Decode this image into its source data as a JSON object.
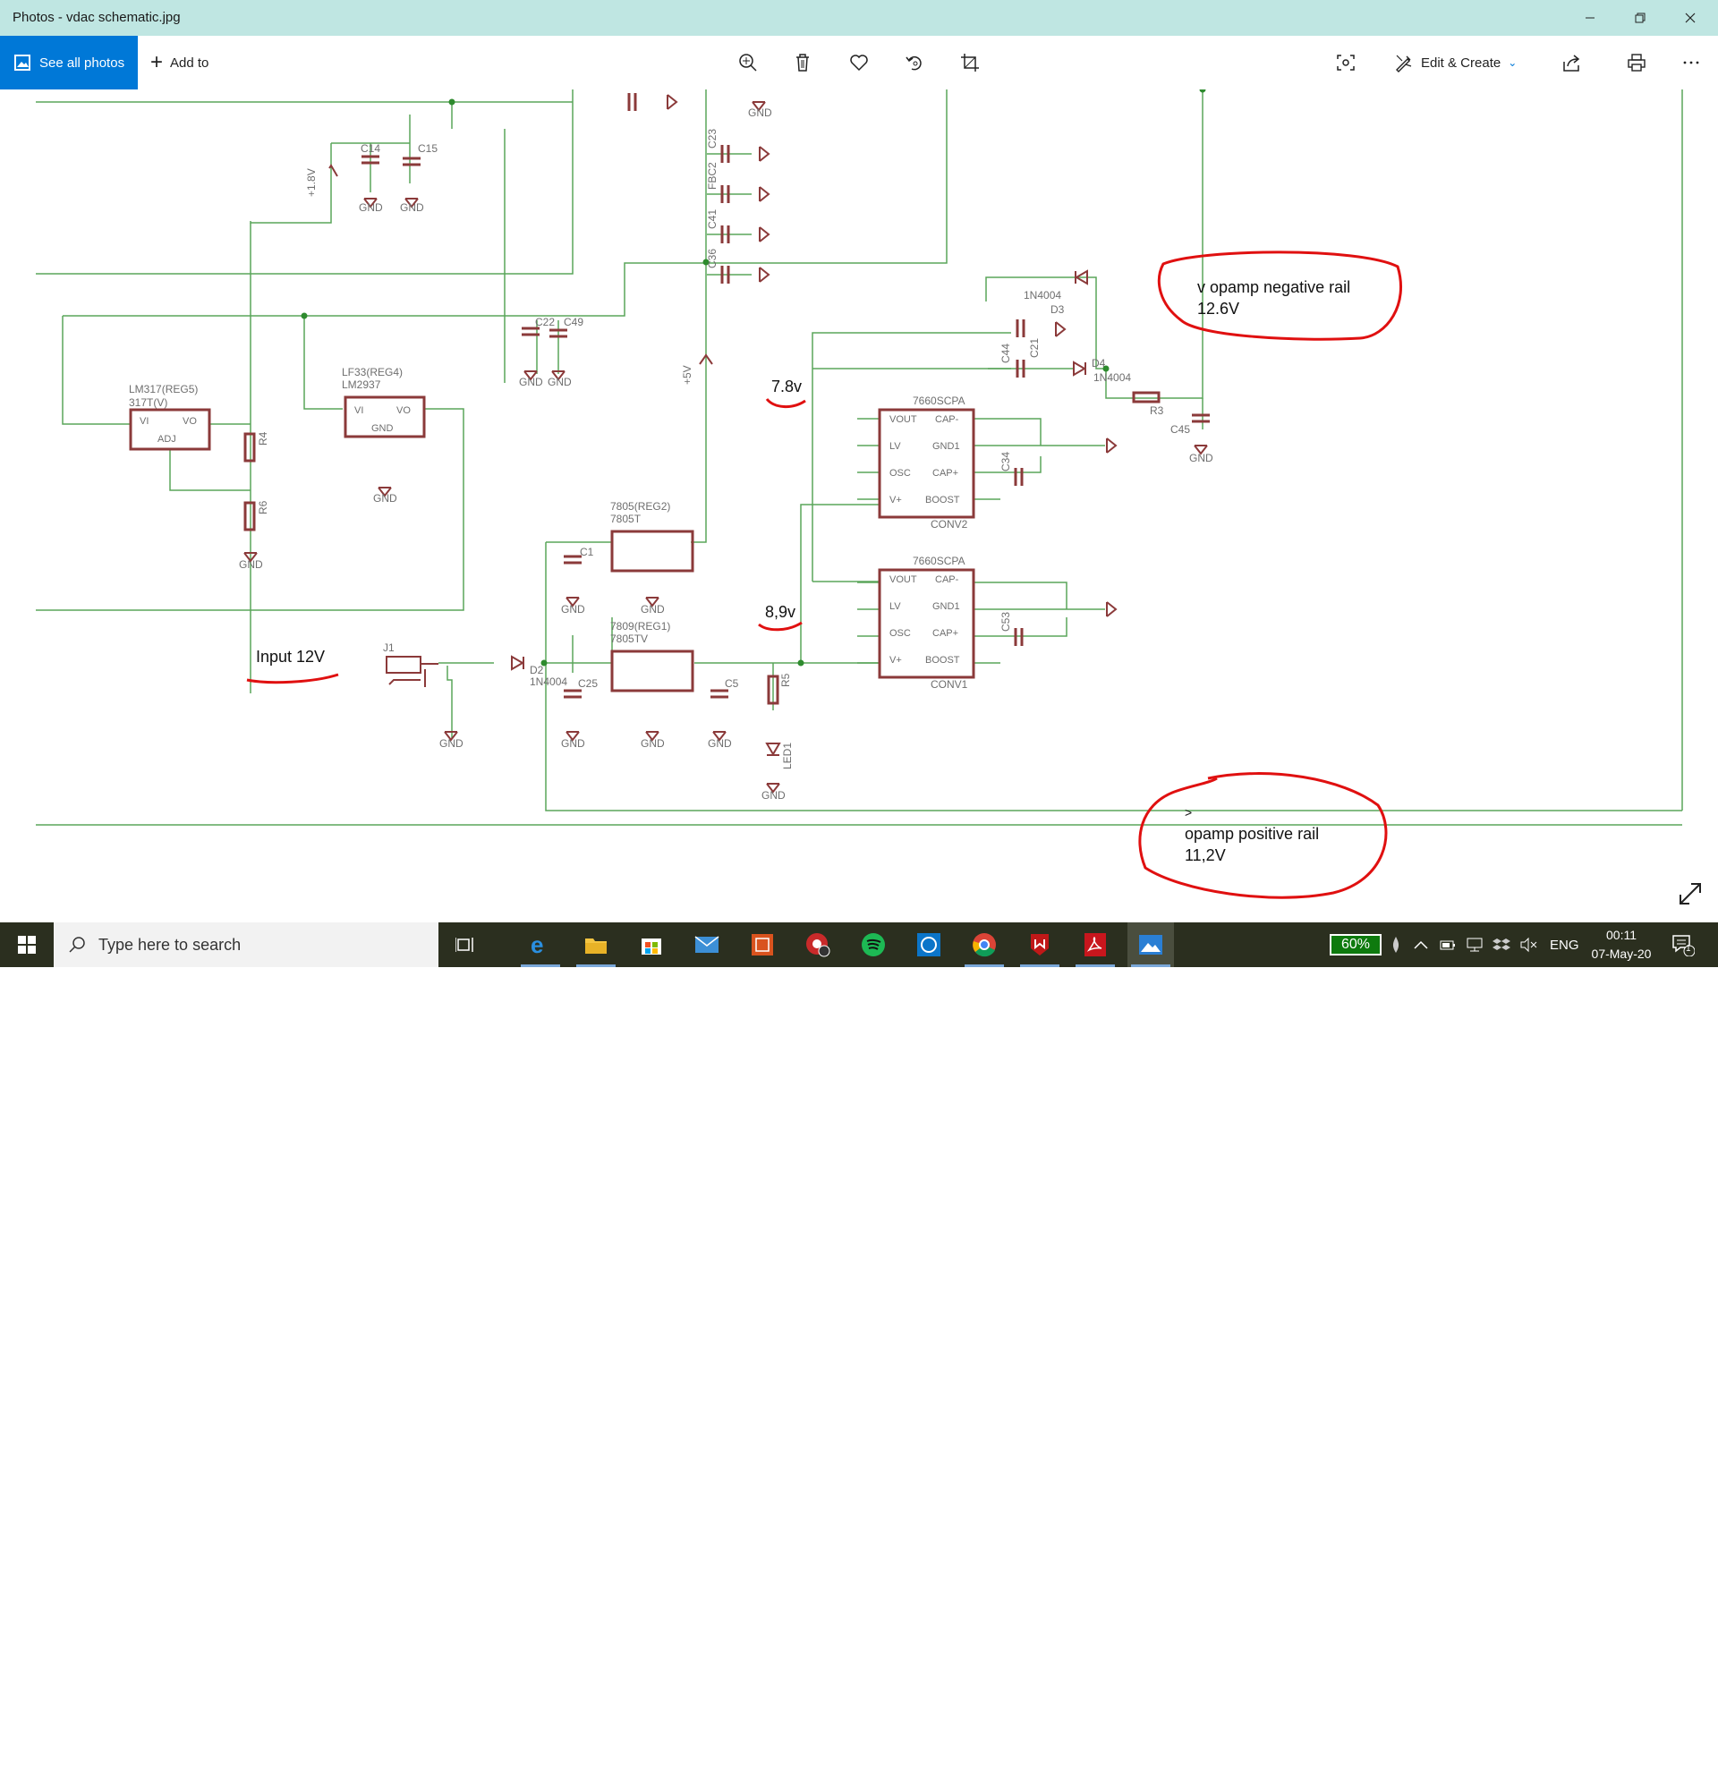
{
  "window": {
    "title": "Photos - vdac schematic.jpg",
    "controls": [
      "minimize",
      "restore",
      "close"
    ]
  },
  "toolbar": {
    "see_all_label": "See all photos",
    "add_to_label": "Add to",
    "edit_create_label": "Edit & Create",
    "icons": [
      "zoom-icon",
      "delete-icon",
      "favorite-icon",
      "rotate-icon",
      "crop-icon",
      "spot-fix-icon",
      "share-icon",
      "print-icon",
      "more-icon"
    ]
  },
  "schematic": {
    "annotations": {
      "input": "Input 12V",
      "v78": "7.8v",
      "v89": "8,9v",
      "neg_rail_line1": "v  opamp negative rail",
      "neg_rail_line2": "12.6V",
      "pos_rail_mark": ">",
      "pos_rail_line1": "opamp positive rail",
      "pos_rail_line2": "11,2V"
    },
    "parts": {
      "reg5_a": "LM317(REG5)",
      "reg5_b": "317T(V)",
      "reg5_vi": "VI",
      "reg5_vo": "VO",
      "reg5_adj": "ADJ",
      "reg4_a": "LF33(REG4)",
      "reg4_b": "LM2937",
      "reg4_vi": "VI",
      "reg4_vo": "VO",
      "reg4_gnd": "GND",
      "reg2_a": "7805(REG2)",
      "reg2_b": "7805T",
      "reg1_a": "7809(REG1)",
      "reg1_b": "7805TV",
      "conv_title": "7660SCPA",
      "conv2": "CONV2",
      "conv1": "CONV1",
      "pin_vout": "VOUT",
      "pin_lv": "LV",
      "pin_osc": "OSC",
      "pin_vplus": "V+",
      "pin_capm": "CAP-",
      "pin_gnd1": "GND1",
      "pin_capp": "CAP+",
      "pin_boost": "BOOST",
      "c14": "C14",
      "c15": "C15",
      "c22": "C22",
      "c49": "C49",
      "c23": "C23",
      "fbc2": "FBC2",
      "c41": "C41",
      "c36": "C36",
      "c1": "C1",
      "c25": "C25",
      "c5": "C5",
      "c44": "C44",
      "c21": "C21",
      "c34": "C34",
      "c53": "C53",
      "c45": "C45",
      "r4": "R4",
      "r6": "R6",
      "r5": "R5",
      "r3": "R3",
      "led1": "LED1",
      "d2": "D2",
      "d3": "D3",
      "d4": "D4",
      "j1": "J1",
      "d1n4004": "1N4004",
      "plus18": "+1.8V",
      "plus5": "+5V",
      "gnd": "GND"
    }
  },
  "taskbar": {
    "search_placeholder": "Type here to search",
    "apps": [
      "task-view",
      "edge",
      "file-explorer",
      "store",
      "mail",
      "photo-app",
      "media-recorder",
      "spotify",
      "whatsapp",
      "chrome",
      "mcafee",
      "acrobat",
      "photos"
    ],
    "battery": "60%",
    "language": "ENG",
    "time": "00:11",
    "date": "07-May-20",
    "notification_count": "1"
  },
  "colors": {
    "titlebar": "#bfe6e2",
    "accent": "#0078d7",
    "wire": "#5aa55a",
    "component": "#8b3a3a",
    "annotation": "#e01010",
    "taskbar": "#2b2f1f"
  }
}
